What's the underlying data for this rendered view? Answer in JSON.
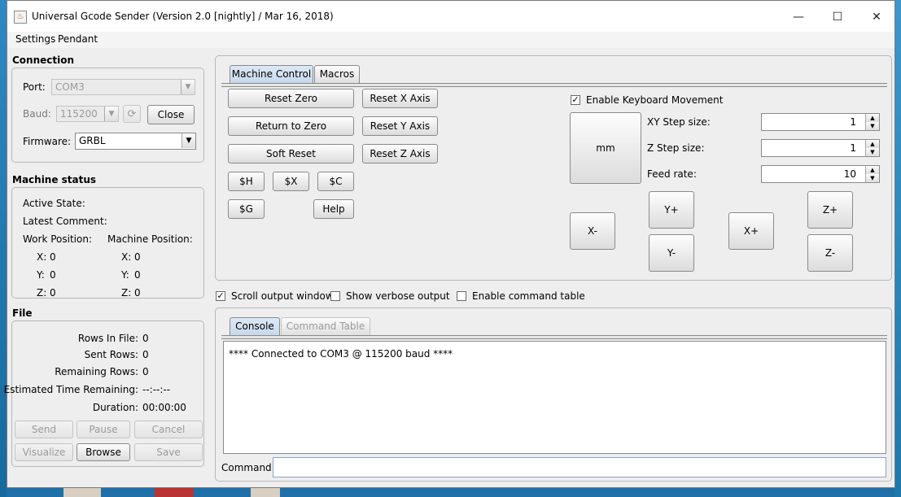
{
  "window": {
    "title": "Universal Gcode Sender (Version 2.0 [nightly]  / Mar 16, 2018)",
    "minimize": "—",
    "maximize": "☐",
    "close": "✕"
  },
  "menu": {
    "settings": "Settings",
    "pendant": "Pendant"
  },
  "connection": {
    "title": "Connection",
    "port_label": "Port:",
    "port_value": "COM3",
    "baud_label": "Baud:",
    "baud_value": "115200",
    "close_label": "Close",
    "firmware_label": "Firmware:",
    "firmware_value": "GRBL"
  },
  "machine_status": {
    "title": "Machine status",
    "active_state": "Active State:",
    "latest_comment": "Latest Comment:",
    "work_position": "Work Position:",
    "machine_position": "Machine Position:",
    "work": {
      "x_label": "X:",
      "x": "0",
      "y_label": "Y:",
      "y": "0",
      "z_label": "Z:",
      "z": "0"
    },
    "machine": {
      "x_label": "X:",
      "x": "0",
      "y_label": "Y:",
      "y": "0",
      "z_label": "Z:",
      "z": "0"
    }
  },
  "file": {
    "title": "File",
    "rows_in_file_label": "Rows In File:",
    "rows_in_file": "0",
    "sent_rows_label": "Sent Rows:",
    "sent_rows": "0",
    "remaining_rows_label": "Remaining Rows:",
    "remaining_rows": "0",
    "est_time_label": "Estimated Time Remaining:",
    "est_time": "--:--:--",
    "duration_label": "Duration:",
    "duration": "00:00:00",
    "send": "Send",
    "pause": "Pause",
    "cancel": "Cancel",
    "visualize": "Visualize",
    "browse": "Browse",
    "save": "Save"
  },
  "control": {
    "tab_machine_control": "Machine Control",
    "tab_macros": "Macros",
    "reset_zero": "Reset Zero",
    "return_to_zero": "Return to Zero",
    "soft_reset": "Soft Reset",
    "reset_x": "Reset X Axis",
    "reset_y": "Reset Y Axis",
    "reset_z": "Reset Z Axis",
    "cmd_h": "$H",
    "cmd_x": "$X",
    "cmd_c": "$C",
    "cmd_g": "$G",
    "help": "Help",
    "enable_keyboard": "Enable Keyboard Movement",
    "unit": "mm",
    "xy_step_label": "XY Step size:",
    "xy_step": "1",
    "z_step_label": "Z Step size:",
    "z_step": "1",
    "feed_rate_label": "Feed rate:",
    "feed_rate": "10",
    "x_minus": "X-",
    "x_plus": "X+",
    "y_plus": "Y+",
    "y_minus": "Y-",
    "z_plus": "Z+",
    "z_minus": "Z-"
  },
  "options": {
    "scroll_output": "Scroll output window",
    "verbose_output": "Show verbose output",
    "command_table": "Enable command table"
  },
  "console": {
    "tab_console": "Console",
    "tab_command_table": "Command Table",
    "output": "**** Connected to COM3 @ 115200 baud ****",
    "command_label": "Command:"
  },
  "colors": {
    "desktop": "#1f6fa8",
    "window_bg": "#eeeeee",
    "active_tab": "#c7d8ec"
  }
}
